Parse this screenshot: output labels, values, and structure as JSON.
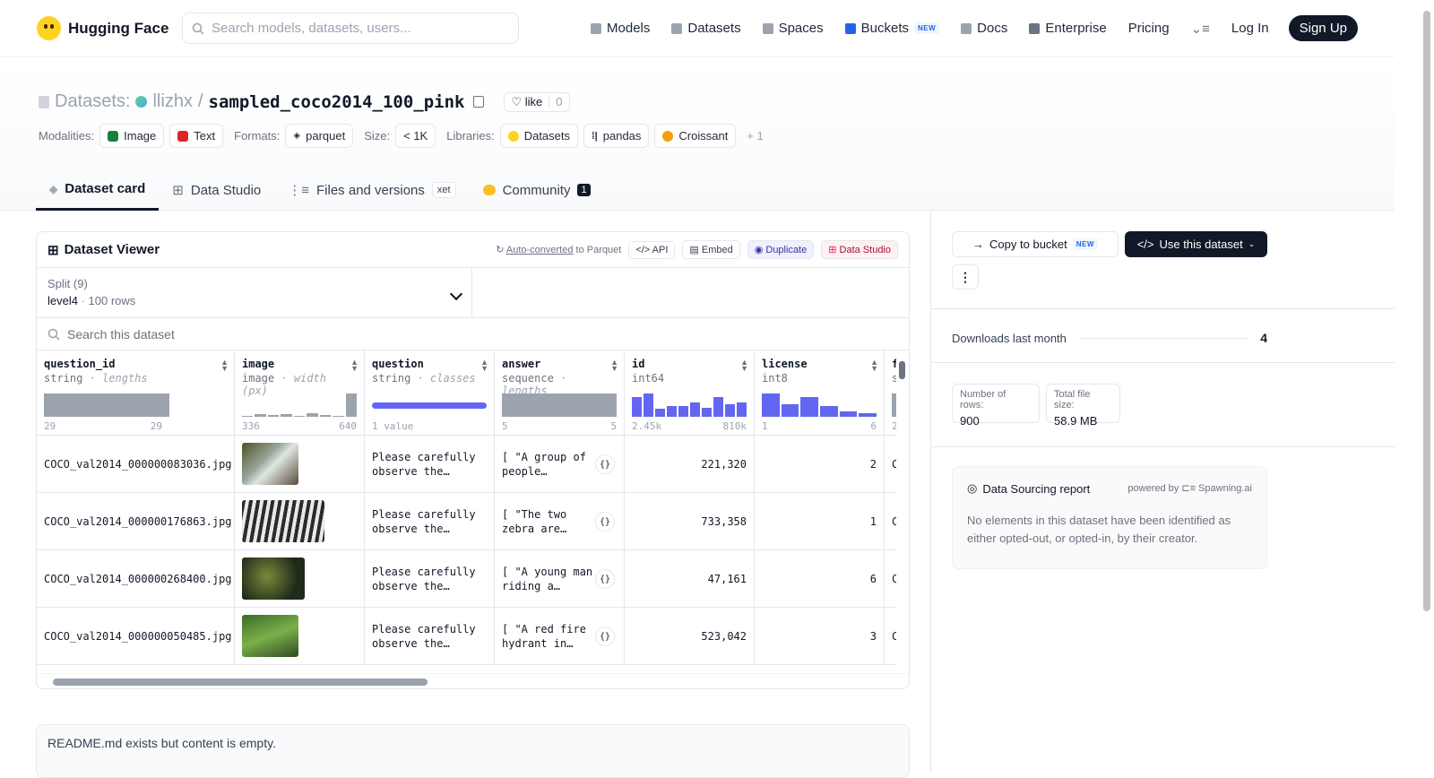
{
  "header": {
    "brand": "Hugging Face",
    "search_placeholder": "Search models, datasets, users...",
    "nav": [
      {
        "label": "Models",
        "icon": "models-icon"
      },
      {
        "label": "Datasets",
        "icon": "datasets-icon"
      },
      {
        "label": "Spaces",
        "icon": "spaces-icon"
      },
      {
        "label": "Buckets",
        "icon": "buckets-icon",
        "badge": "NEW"
      },
      {
        "label": "Docs",
        "icon": "docs-icon"
      },
      {
        "label": "Enterprise",
        "icon": "enterprise-icon"
      },
      {
        "label": "Pricing"
      }
    ],
    "login": "Log In",
    "signup": "Sign Up"
  },
  "dataset": {
    "prefix": "Datasets:",
    "owner": "llizhx",
    "separator": "/",
    "name": "sampled_coco2014_100_pink",
    "like_label": "like",
    "like_count": "0",
    "modalities_label": "Modalities:",
    "modalities": [
      "Image",
      "Text"
    ],
    "formats_label": "Formats:",
    "formats": [
      "parquet"
    ],
    "size_label": "Size:",
    "size": "< 1K",
    "libraries_label": "Libraries:",
    "libraries": [
      "Datasets",
      "pandas",
      "Croissant"
    ],
    "libraries_more": "+ 1"
  },
  "tabs": [
    {
      "label": "Dataset card",
      "active": true
    },
    {
      "label": "Data Studio"
    },
    {
      "label": "Files and versions",
      "badge": "xet"
    },
    {
      "label": "Community",
      "badge": "1"
    }
  ],
  "viewer": {
    "title": "Dataset Viewer",
    "auto_converted": "Auto-converted",
    "to_parquet": " to Parquet",
    "buttons": [
      "API",
      "Embed",
      "Duplicate",
      "Data Studio"
    ],
    "split_label": "Split (9)",
    "split_value": "level4",
    "split_rows": "100 rows",
    "search_placeholder": "Search this dataset",
    "columns": [
      {
        "name": "question_id",
        "type": "string",
        "sub": "lengths",
        "range": [
          "29",
          "29"
        ],
        "hist": [
          1
        ],
        "style": "gray"
      },
      {
        "name": "image",
        "type": "image",
        "sub": "width (px)",
        "range": [
          "336",
          "640"
        ],
        "hist": [
          0.05,
          0.1,
          0.08,
          0.12,
          0.05,
          0.15,
          0.07,
          0.04,
          1
        ],
        "style": "gray"
      },
      {
        "name": "question",
        "type": "string",
        "sub": "classes",
        "range": [
          "1 value",
          ""
        ],
        "hist": [
          1
        ],
        "style": "bar"
      },
      {
        "name": "answer",
        "type": "sequence",
        "sub": "lengths",
        "range": [
          "5",
          "5"
        ],
        "hist": [
          1
        ],
        "style": "gray"
      },
      {
        "name": "id",
        "type": "int64",
        "sub": "",
        "range": [
          "2.45k",
          "810k"
        ],
        "hist": [
          0.85,
          1,
          0.35,
          0.45,
          0.45,
          0.6,
          0.4,
          0.85,
          0.55,
          0.6
        ],
        "style": "blue"
      },
      {
        "name": "license",
        "type": "int8",
        "sub": "",
        "range": [
          "1",
          "6"
        ],
        "hist": [
          1,
          0.55,
          0.85,
          0.45,
          0.25,
          0.15
        ],
        "style": "blue"
      },
      {
        "name": "f",
        "type": "s",
        "sub": "",
        "range": [
          "2",
          ""
        ],
        "hist": [
          1
        ],
        "style": "gray"
      }
    ],
    "rows": [
      {
        "question_id": "COCO_val2014_000000083036.jpg",
        "question": "Please carefully observe the image…",
        "answer": "[ \"A group of people…",
        "id": "221,320",
        "license": "2",
        "f": "C("
      },
      {
        "question_id": "COCO_val2014_000000176863.jpg",
        "question": "Please carefully observe the image…",
        "answer": "[ \"The two zebra are…",
        "id": "733,358",
        "license": "1",
        "f": "C("
      },
      {
        "question_id": "COCO_val2014_000000268400.jpg",
        "question": "Please carefully observe the image…",
        "answer": "[ \"A young man riding a…",
        "id": "47,161",
        "license": "6",
        "f": "C("
      },
      {
        "question_id": "COCO_val2014_000000050485.jpg",
        "question": "Please carefully observe the image…",
        "answer": "[ \"A red fire hydrant in…",
        "id": "523,042",
        "license": "3",
        "f": "C("
      }
    ]
  },
  "readme": "README.md exists but content is empty.",
  "sidebar": {
    "copy_bucket": "Copy to bucket",
    "copy_badge": "NEW",
    "use_dataset": "Use this dataset",
    "downloads_label": "Downloads last month",
    "downloads": "4",
    "rows_label": "Number of rows:",
    "rows_value": "900",
    "size_label": "Total file size:",
    "size_value": "58.9 MB",
    "report_title": "Data Sourcing report",
    "powered_by": "powered by",
    "powered_name": "Spawning.ai",
    "report_text": "No elements in this dataset have been identified as either opted-out, or opted-in, by their creator."
  },
  "colors": {
    "accent": "#6366f1",
    "dark": "#111827",
    "hist_gray": "#9ca3af"
  }
}
